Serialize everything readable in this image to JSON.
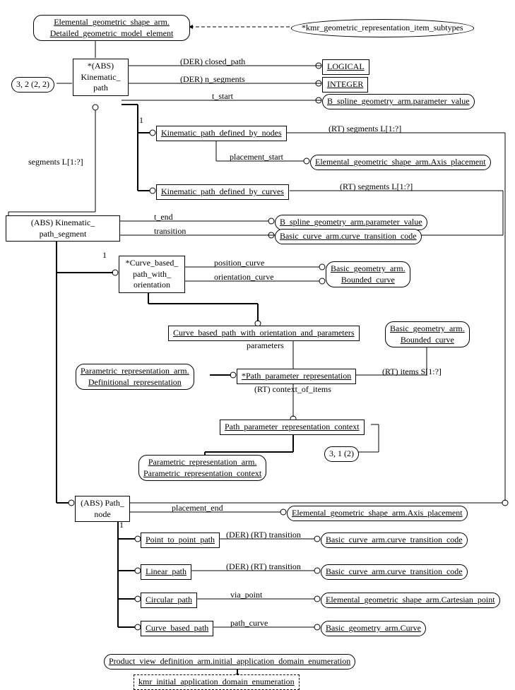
{
  "top_left_box": "Elemental_geometric_shape_arm.\nDetailed_geometric_model_element",
  "top_right_ellipse": "*kmr_geometric_representation_item_subtypes",
  "kinematic_path": "*(ABS)\nKinematic_\npath",
  "circle_3_2": "3, 2 (2, 2)",
  "der_closed_path": "(DER) closed_path",
  "der_n_segments": "(DER) n_segments",
  "t_start": "t_start",
  "logical_box": "LOGICAL",
  "integer_box": "INTEGER",
  "bspline_param": "B_spline_geometry_arm.parameter_value",
  "segments_left": "segments L[1:?]",
  "one_a": "1",
  "kp_nodes": "Kinematic_path_defined_by_nodes",
  "rt_segments1": "(RT) segments L[1:?]",
  "placement_start": "placement_start",
  "axis_placement": "Elemental_geometric_shape_arm.Axis_placement",
  "kp_curves": "Kinematic_path_defined_by_curves",
  "rt_segments2": "(RT) segments L[1:?]",
  "kp_segment": "(ABS) Kinematic_\npath_segment",
  "t_end": "t_end",
  "transition": "transition",
  "bspline_param2": "B_spline_geometry_arm.parameter_value",
  "trans_code": "Basic_curve_arm.curve_transition_code",
  "one_b": "1",
  "curve_based_or": "*Curve_based_\npath_with_\norientation",
  "position_curve": "position_curve",
  "orientation_curve": "orientation_curve",
  "bounded_curve": "Basic_geometry_arm.\nBounded_curve",
  "cbp_w_params": "Curve_based_path_with_orientation_and_parameters",
  "parameters": "parameters",
  "bounded_curve2": "Basic_geometry_arm.\nBounded_curve",
  "param_rep_arm": "Parametric_representation_arm.\nDefinitional_representation",
  "path_param_rep": "*Path_parameter_representation",
  "rt_items": "(RT) items S[1:?]",
  "rt_context": "(RT) context_of_items",
  "ppr_context": "Path_parameter_representation_context",
  "prc_arm": "Parametric_representation_arm.\nParametric_representation_context",
  "circle_3_1": "3, 1 (2)",
  "path_node": "(ABS) Path_\nnode",
  "placement_end": "placement_end",
  "axis_placement2": "Elemental_geometric_shape_arm.Axis_placement",
  "one_c": "1",
  "p2p_path": "Point_to_point_path",
  "der_rt_trans": "(DER) (RT) transition",
  "trans_code2": "Basic_curve_arm.curve_transition_code",
  "linear_path": "Linear_path",
  "der_rt_trans2": "(DER) (RT) transition",
  "trans_code3": "Basic_curve_arm.curve_transition_code",
  "circular_path": "Circular_path",
  "via_point": "via_point",
  "cart_point": "Elemental_geometric_shape_arm.Cartesian_point",
  "curve_based_path": "Curve_based_path",
  "path_curve": "path_curve",
  "curve": "Basic_geometry_arm.Curve",
  "pvd_enum": "Product_view_definition_arm.initial_application_domain_enumeration",
  "kmr_enum": "kmr_initial_application_domain_enumeration"
}
